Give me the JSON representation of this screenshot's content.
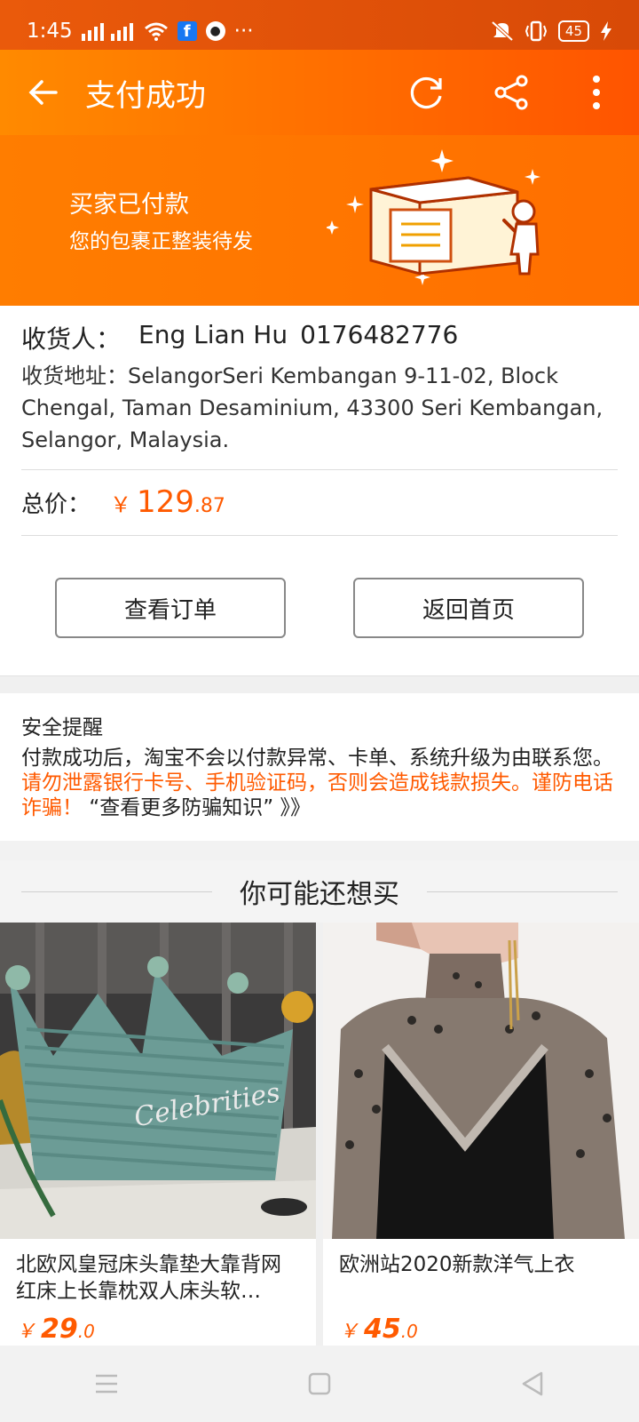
{
  "status_bar": {
    "time": "1:45",
    "battery": "45",
    "overflow": "···",
    "fb_letter": "f"
  },
  "app_bar": {
    "title": "支付成功",
    "icons": [
      "back-arrow-icon",
      "refresh-icon",
      "share-icon",
      "more-vertical-icon"
    ]
  },
  "banner": {
    "title": "买家已付款",
    "subtitle": "您的包裹正整装待发"
  },
  "receiver": {
    "label": "收货人：",
    "name": "Eng Lian Hu",
    "phone": "0176482776",
    "address_label": "收货地址：",
    "address": "SelangorSeri Kembangan 9-11-02, Block Chengal, Taman Desaminium, 43300 Seri Kembangan, Selangor, Malaysia."
  },
  "total": {
    "label": "总价：",
    "currency": "￥",
    "integer": "129",
    "decimal": ".87"
  },
  "actions": {
    "view_order": "查看订单",
    "back_home": "返回首页"
  },
  "safety": {
    "title": "安全提醒",
    "text_normal": "付款成功后，淘宝不会以付款异常、卡单、系统升级为由联系您。",
    "text_warning": "请勿泄露银行卡号、手机验证码，否则会造成钱款损失。谨防电话诈骗！",
    "link": "“查看更多防骗知识” 》》"
  },
  "recommend": {
    "title": "你可能还想买",
    "items": [
      {
        "title": "北欧风皇冠床头靠垫大靠背网红床上长靠枕双人床头软…",
        "currency": "￥",
        "price_int": "29",
        "price_dec": ".0",
        "image_text": "Celebrities"
      },
      {
        "title": "欧洲站2020新款洋气上衣",
        "currency": "￥",
        "price_int": "45",
        "price_dec": ".0"
      }
    ]
  },
  "colors": {
    "accent": "#ff6a00",
    "price": "#ff5a00",
    "status_bar": "#e0520a"
  }
}
